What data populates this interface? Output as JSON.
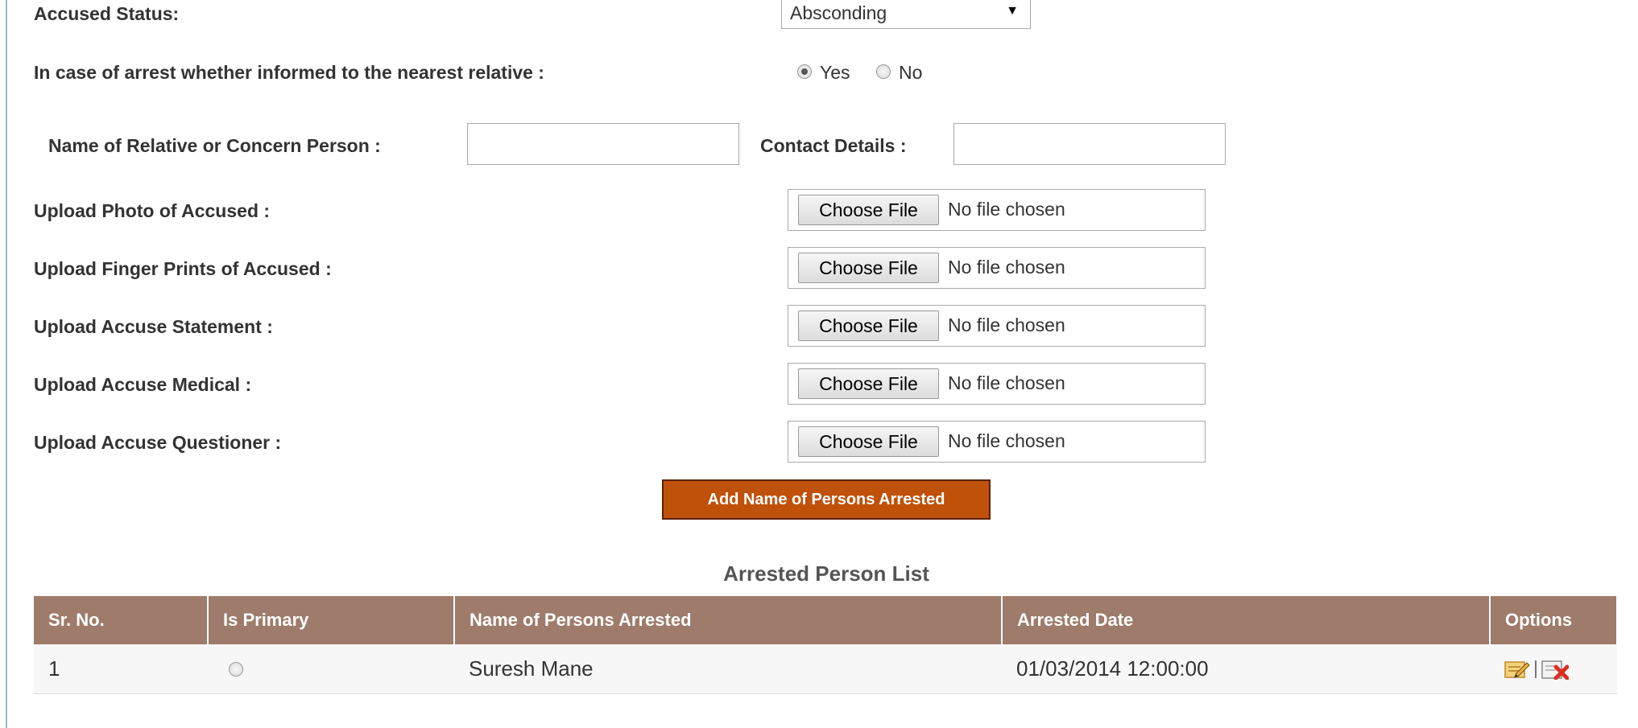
{
  "form": {
    "accused_status_label": "Accused Status:",
    "accused_status_value": "Absconding",
    "informed_label": "In case of arrest whether informed to the nearest relative :",
    "informed_yes": "Yes",
    "informed_no": "No",
    "relative_label": "Name of Relative or Concern Person :",
    "relative_value": "",
    "contact_label": "Contact Details :",
    "contact_value": "",
    "uploads": [
      {
        "label": "Upload Photo of Accused :",
        "button": "Choose File",
        "file": "No file chosen"
      },
      {
        "label": "Upload Finger Prints of Accused :",
        "button": "Choose File",
        "file": "No file chosen"
      },
      {
        "label": "Upload Accuse  Statement :",
        "button": "Choose File",
        "file": "No file chosen"
      },
      {
        "label": "Upload Accuse Medical :",
        "button": "Choose File",
        "file": "No file chosen"
      },
      {
        "label": "Upload Accuse Questioner :",
        "button": "Choose File",
        "file": "No file chosen"
      }
    ],
    "add_button": "Add Name of Persons Arrested"
  },
  "list": {
    "title": "Arrested Person List",
    "headers": [
      "Sr. No.",
      "Is Primary",
      "Name of Persons Arrested",
      "Arrested Date",
      "Options"
    ],
    "rows": [
      {
        "sr": "1",
        "name": "Suresh Mane",
        "date": "01/03/2014 12:00:00"
      }
    ]
  },
  "colors": {
    "header_bg": "#9e7b6b",
    "button_bg": "#c0510a"
  }
}
